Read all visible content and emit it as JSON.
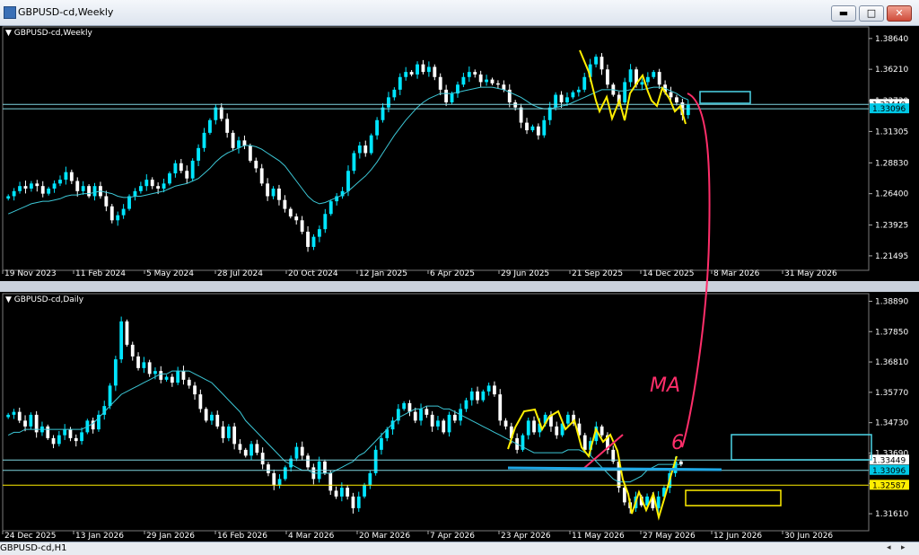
{
  "window": {
    "title": "GBPUSD-cd,Weekly",
    "buttons": {
      "minimize": "▬",
      "restore": "□",
      "close": "✕"
    }
  },
  "bottom_tab": "GBPUSD-cd,H1",
  "colors": {
    "up": "#00e5ff",
    "down": "#ffffff",
    "ma": "#3cc7d6",
    "grid": "#333333",
    "yellow_markup": "#ffee00",
    "pink_markup": "#ff2e6a",
    "blue_markup": "#1fa8e6"
  },
  "annotations": {
    "handwritten_text": "MA",
    "handwritten_digit": "6"
  },
  "chart_data": [
    {
      "type": "candlestick",
      "title": "GBPUSD-cd,Weekly",
      "ylim": [
        1.2085,
        1.3955
      ],
      "y_ticks": [
        "1.38640",
        "1.36210",
        "1.33730",
        "1.31305",
        "1.28830",
        "1.26400",
        "1.23925",
        "1.21495"
      ],
      "x_labels": [
        "19 Nov 2023",
        "11 Feb 2024",
        "5 May 2024",
        "28 Jul 2024",
        "20 Oct 2024",
        "12 Jan 2025",
        "6 Apr 2025",
        "29 Jun 2025",
        "21 Sep 2025",
        "14 Dec 2025",
        "8 Mar 2026",
        "31 May 2026"
      ],
      "price_labels": [
        {
          "text": "1.33440",
          "value": 1.3344
        },
        {
          "text": "1.33096",
          "value": 1.33096
        }
      ],
      "close_path": [
        1.262,
        1.266,
        1.27,
        1.268,
        1.272,
        1.27,
        1.264,
        1.268,
        1.272,
        1.275,
        1.281,
        1.274,
        1.266,
        1.27,
        1.262,
        1.27,
        1.262,
        1.254,
        1.243,
        1.247,
        1.252,
        1.262,
        1.266,
        1.27,
        1.275,
        1.27,
        1.268,
        1.272,
        1.28,
        1.288,
        1.282,
        1.276,
        1.29,
        1.3,
        1.312,
        1.322,
        1.332,
        1.323,
        1.312,
        1.3,
        1.306,
        1.302,
        1.29,
        1.284,
        1.272,
        1.262,
        1.268,
        1.259,
        1.252,
        1.246,
        1.243,
        1.234,
        1.222,
        1.23,
        1.236,
        1.248,
        1.258,
        1.262,
        1.266,
        1.282,
        1.296,
        1.302,
        1.296,
        1.31,
        1.322,
        1.332,
        1.34,
        1.346,
        1.356,
        1.36,
        1.358,
        1.366,
        1.36,
        1.364,
        1.356,
        1.346,
        1.336,
        1.343,
        1.35,
        1.356,
        1.36,
        1.358,
        1.352,
        1.354,
        1.351,
        1.35,
        1.346,
        1.336,
        1.332,
        1.32,
        1.314,
        1.317,
        1.31,
        1.322,
        1.332,
        1.342,
        1.336,
        1.34,
        1.344,
        1.346,
        1.356,
        1.366,
        1.372,
        1.362,
        1.35,
        1.342,
        1.336,
        1.352,
        1.362,
        1.35,
        1.352,
        1.356,
        1.36,
        1.35,
        1.344,
        1.34,
        1.336,
        1.326,
        1.334
      ],
      "ma_path": [
        1.248,
        1.25,
        1.252,
        1.254,
        1.256,
        1.257,
        1.258,
        1.258,
        1.259,
        1.26,
        1.262,
        1.263,
        1.263,
        1.264,
        1.264,
        1.265,
        1.266,
        1.265,
        1.264,
        1.262,
        1.261,
        1.261,
        1.262,
        1.262,
        1.263,
        1.264,
        1.265,
        1.266,
        1.268,
        1.27,
        1.271,
        1.272,
        1.274,
        1.276,
        1.28,
        1.284,
        1.289,
        1.293,
        1.296,
        1.298,
        1.3,
        1.302,
        1.302,
        1.301,
        1.299,
        1.296,
        1.293,
        1.29,
        1.286,
        1.28,
        1.274,
        1.268,
        1.262,
        1.258,
        1.256,
        1.257,
        1.259,
        1.261,
        1.263,
        1.266,
        1.27,
        1.274,
        1.278,
        1.283,
        1.289,
        1.296,
        1.303,
        1.31,
        1.316,
        1.322,
        1.327,
        1.332,
        1.336,
        1.339,
        1.341,
        1.343,
        1.343,
        1.343,
        1.344,
        1.345,
        1.346,
        1.347,
        1.348,
        1.348,
        1.348,
        1.347,
        1.346,
        1.344,
        1.342,
        1.34,
        1.337,
        1.334,
        1.332,
        1.331,
        1.331,
        1.332,
        1.333,
        1.334,
        1.336,
        1.338,
        1.34,
        1.342,
        1.344,
        1.346,
        1.346,
        1.346,
        1.345,
        1.345,
        1.346,
        1.346,
        1.346,
        1.347,
        1.348,
        1.348,
        1.347,
        1.345,
        1.343,
        1.34,
        1.338
      ]
    },
    {
      "type": "candlestick",
      "title": "GBPUSD-cd,Daily",
      "ylim": [
        1.3115,
        1.3915
      ],
      "y_ticks": [
        "1.38890",
        "1.37850",
        "1.36810",
        "1.35770",
        "1.34730",
        "1.33690",
        "1.32650",
        "1.31610"
      ],
      "x_labels": [
        "24 Dec 2025",
        "13 Jan 2026",
        "29 Jan 2026",
        "16 Feb 2026",
        "4 Mar 2026",
        "20 Mar 2026",
        "7 Apr 2026",
        "23 Apr 2026",
        "11 May 2026",
        "27 May 2026",
        "12 Jun 2026",
        "30 Jun 2026"
      ],
      "price_labels": [
        {
          "text": "1.33449",
          "value": 1.33449
        },
        {
          "text": "1.33096",
          "value": 1.33096
        },
        {
          "text": "1.32587",
          "value": 1.32587
        }
      ],
      "close_path": [
        1.35,
        1.351,
        1.348,
        1.346,
        1.35,
        1.344,
        1.346,
        1.342,
        1.34,
        1.343,
        1.345,
        1.342,
        1.341,
        1.344,
        1.348,
        1.345,
        1.35,
        1.353,
        1.36,
        1.369,
        1.382,
        1.374,
        1.37,
        1.366,
        1.368,
        1.364,
        1.365,
        1.362,
        1.363,
        1.361,
        1.365,
        1.362,
        1.36,
        1.357,
        1.352,
        1.348,
        1.35,
        1.346,
        1.342,
        1.346,
        1.34,
        1.338,
        1.336,
        1.34,
        1.337,
        1.333,
        1.33,
        1.326,
        1.328,
        1.332,
        1.335,
        1.339,
        1.336,
        1.332,
        1.328,
        1.334,
        1.33,
        1.324,
        1.322,
        1.325,
        1.322,
        1.318,
        1.322,
        1.326,
        1.33,
        1.338,
        1.342,
        1.345,
        1.348,
        1.352,
        1.354,
        1.351,
        1.348,
        1.352,
        1.35,
        1.346,
        1.348,
        1.344,
        1.35,
        1.348,
        1.352,
        1.355,
        1.358,
        1.355,
        1.358,
        1.36,
        1.357,
        1.348,
        1.346,
        1.342,
        1.338,
        1.343,
        1.348,
        1.344,
        1.347,
        1.35,
        1.346,
        1.343,
        1.347,
        1.35,
        1.347,
        1.343,
        1.338,
        1.341,
        1.346,
        1.343,
        1.338,
        1.334,
        1.325,
        1.32,
        1.318,
        1.322,
        1.319,
        1.322,
        1.318,
        1.322,
        1.325,
        1.33,
        1.334,
        1.333
      ],
      "ma_path": [
        1.343,
        1.344,
        1.344,
        1.345,
        1.345,
        1.345,
        1.345,
        1.345,
        1.345,
        1.345,
        1.345,
        1.345,
        1.345,
        1.345,
        1.346,
        1.347,
        1.349,
        1.351,
        1.353,
        1.355,
        1.357,
        1.358,
        1.359,
        1.36,
        1.361,
        1.362,
        1.363,
        1.364,
        1.364,
        1.365,
        1.365,
        1.365,
        1.365,
        1.364,
        1.363,
        1.362,
        1.361,
        1.359,
        1.357,
        1.355,
        1.353,
        1.351,
        1.348,
        1.346,
        1.344,
        1.342,
        1.34,
        1.338,
        1.336,
        1.334,
        1.333,
        1.332,
        1.331,
        1.331,
        1.33,
        1.33,
        1.33,
        1.33,
        1.331,
        1.332,
        1.333,
        1.334,
        1.336,
        1.337,
        1.339,
        1.341,
        1.343,
        1.345,
        1.347,
        1.349,
        1.35,
        1.351,
        1.352,
        1.352,
        1.353,
        1.353,
        1.353,
        1.352,
        1.352,
        1.351,
        1.35,
        1.349,
        1.348,
        1.347,
        1.346,
        1.345,
        1.344,
        1.343,
        1.342,
        1.341,
        1.34,
        1.339,
        1.338,
        1.337,
        1.337,
        1.337,
        1.337,
        1.337,
        1.337,
        1.338,
        1.338,
        1.338,
        1.337,
        1.336,
        1.334,
        1.332,
        1.33,
        1.328,
        1.327,
        1.327,
        1.327,
        1.328,
        1.329,
        1.331,
        1.332,
        1.333,
        1.333,
        1.333,
        1.333,
        1.333
      ]
    }
  ]
}
